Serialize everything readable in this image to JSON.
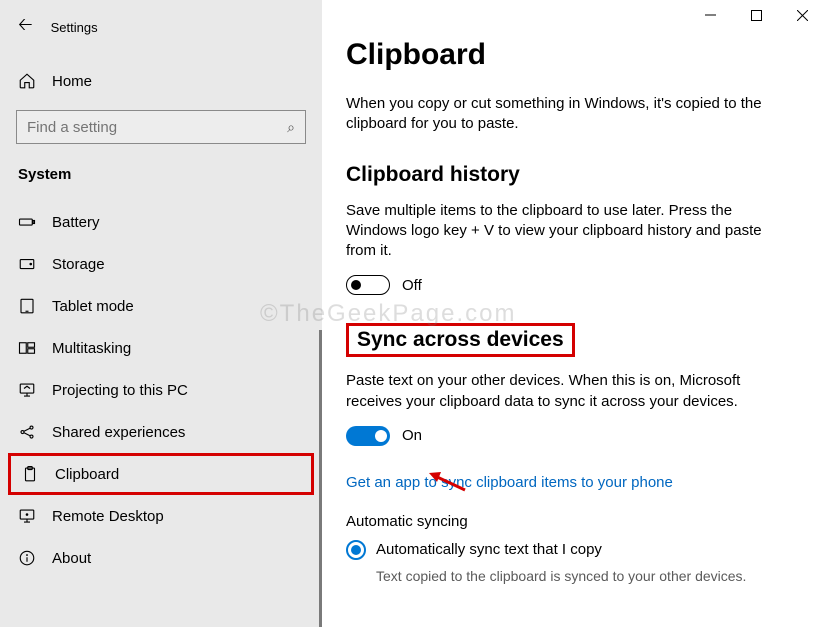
{
  "window": {
    "title": "Settings"
  },
  "sidebar": {
    "home": "Home",
    "searchPlaceholder": "Find a setting",
    "category": "System",
    "items": [
      {
        "label": "Battery"
      },
      {
        "label": "Storage"
      },
      {
        "label": "Tablet mode"
      },
      {
        "label": "Multitasking"
      },
      {
        "label": "Projecting to this PC"
      },
      {
        "label": "Shared experiences"
      },
      {
        "label": "Clipboard"
      },
      {
        "label": "Remote Desktop"
      },
      {
        "label": "About"
      }
    ]
  },
  "main": {
    "title": "Clipboard",
    "intro": "When you copy or cut something in Windows, it's copied to the clipboard for you to paste.",
    "history": {
      "heading": "Clipboard history",
      "desc": "Save multiple items to the clipboard to use later. Press the Windows logo key + V to view your clipboard history and paste from it.",
      "state": "Off"
    },
    "sync": {
      "heading": "Sync across devices",
      "desc": "Paste text on your other devices. When this is on, Microsoft receives your clipboard data to sync it across your devices.",
      "state": "On",
      "link": "Get an app to sync clipboard items to your phone",
      "autoHeading": "Automatic syncing",
      "radio1": "Automatically sync text that I copy",
      "radio1sub": "Text copied to the clipboard is synced to your other devices."
    }
  },
  "watermark": "©TheGeekPage.com"
}
